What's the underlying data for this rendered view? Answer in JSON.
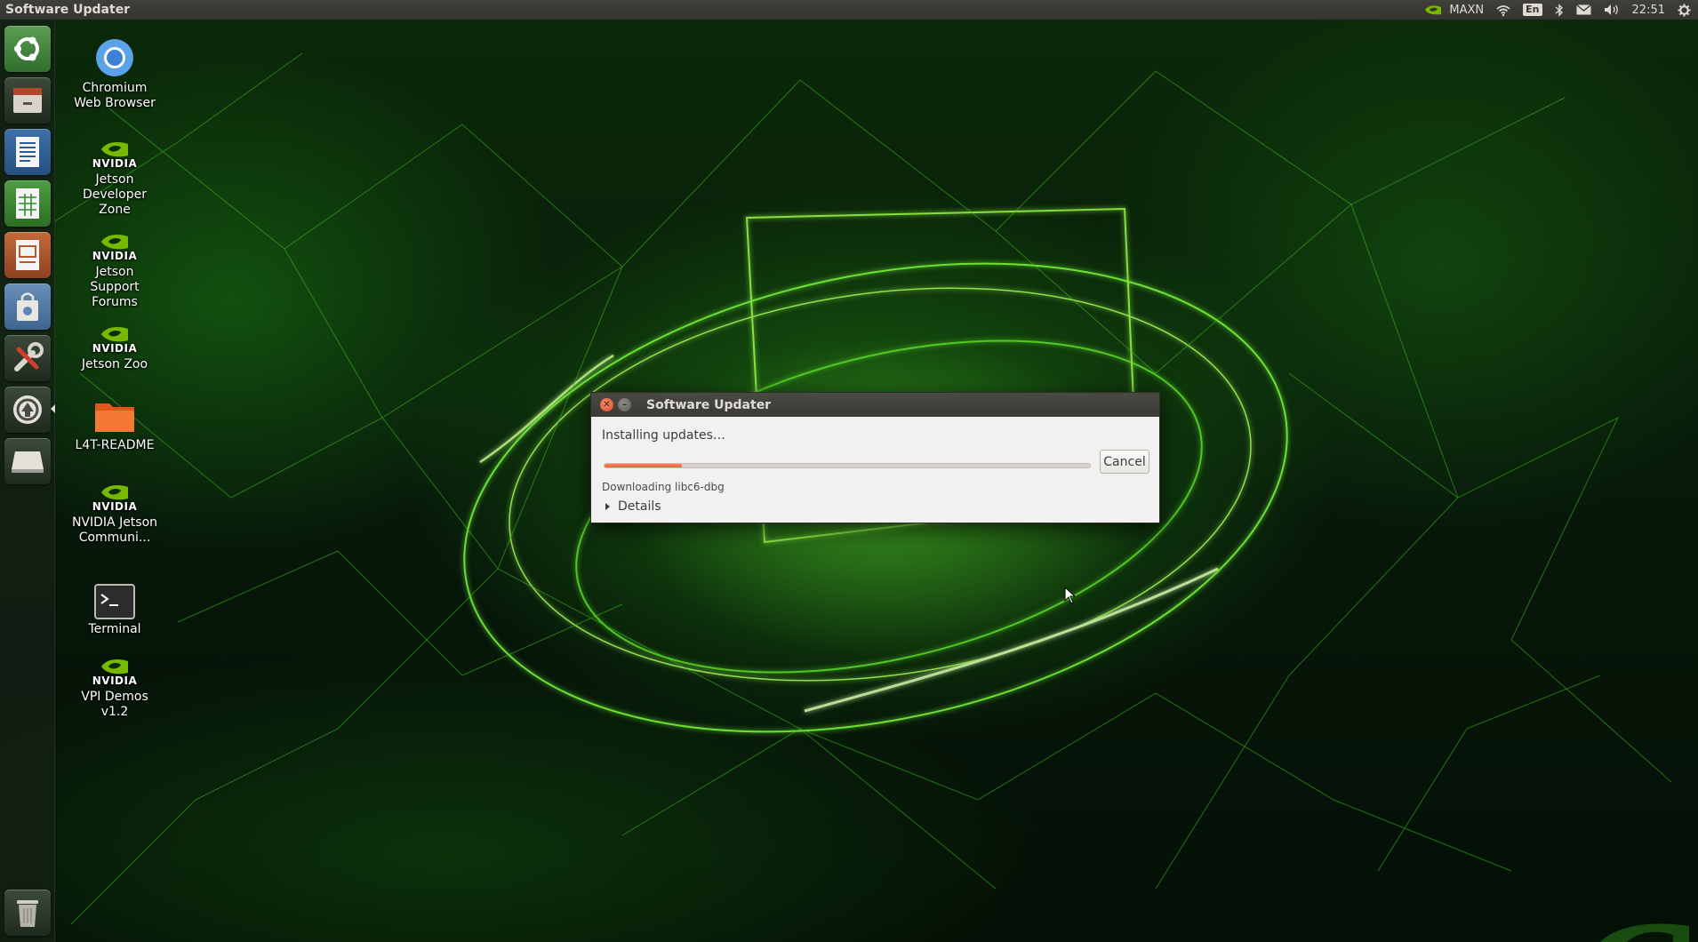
{
  "top_panel": {
    "app_title": "Software Updater",
    "power_mode": "MAXN",
    "keyboard_layout": "En",
    "clock": "22:51",
    "icons": [
      "nvidia-icon",
      "wifi-icon",
      "keyboard-layout-icon",
      "bluetooth-icon",
      "mail-icon",
      "volume-icon",
      "settings-gear-icon"
    ]
  },
  "launcher": {
    "items": [
      {
        "name": "ubuntu-dash"
      },
      {
        "name": "files"
      },
      {
        "name": "libreoffice-writer"
      },
      {
        "name": "libreoffice-calc"
      },
      {
        "name": "libreoffice-impress"
      },
      {
        "name": "ubuntu-software"
      },
      {
        "name": "system-settings"
      },
      {
        "name": "software-updater",
        "active": true
      },
      {
        "name": "removable-drive"
      },
      {
        "name": "trash"
      }
    ]
  },
  "desktop": {
    "icons": [
      {
        "label": "Chromium Web Browser",
        "icon": "chromium-icon"
      },
      {
        "label": "Jetson Developer Zone",
        "icon": "nvidia-icon"
      },
      {
        "label": "Jetson Support Forums",
        "icon": "nvidia-icon"
      },
      {
        "label": "Jetson Zoo",
        "icon": "nvidia-icon"
      },
      {
        "label": "L4T-README",
        "icon": "folder-icon"
      },
      {
        "label": "NVIDIA Jetson Communi...",
        "icon": "nvidia-icon"
      },
      {
        "label": "Terminal",
        "icon": "terminal-icon"
      },
      {
        "label": "VPI Demos v1.2",
        "icon": "nvidia-icon"
      }
    ],
    "nvidia_word": "NVIDIA"
  },
  "dialog": {
    "title": "Software Updater",
    "heading": "Installing updates…",
    "progress": 0.16,
    "cancel_label": "Cancel",
    "status": "Downloading libc6-dbg",
    "details_label": "Details",
    "colors": {
      "progress": "#e8602e",
      "close_button": "#df4c26"
    }
  }
}
